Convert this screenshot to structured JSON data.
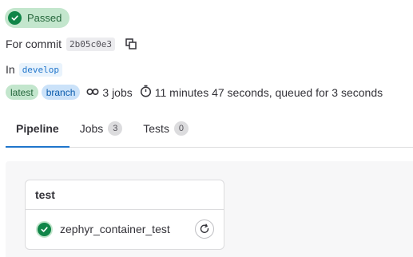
{
  "status": {
    "label": "Passed",
    "icon": "check-circle-icon",
    "color": "#108548"
  },
  "commit": {
    "prefix": "For commit",
    "sha": "2b05c0e3",
    "copy_icon": "copy-icon"
  },
  "branch": {
    "prefix": "In",
    "name": "develop"
  },
  "meta": {
    "badges": [
      "latest",
      "branch"
    ],
    "jobs_text": "3 jobs",
    "duration_text": "11 minutes 47 seconds, queued for 3 seconds"
  },
  "tabs": [
    {
      "label": "Pipeline",
      "active": true
    },
    {
      "label": "Jobs",
      "count": "3"
    },
    {
      "label": "Tests",
      "count": "0"
    }
  ],
  "stage": {
    "title": "test",
    "job": {
      "name": "zephyr_container_test",
      "status": "passed"
    }
  },
  "colors": {
    "accent": "#1f75cb",
    "success": "#108548"
  }
}
